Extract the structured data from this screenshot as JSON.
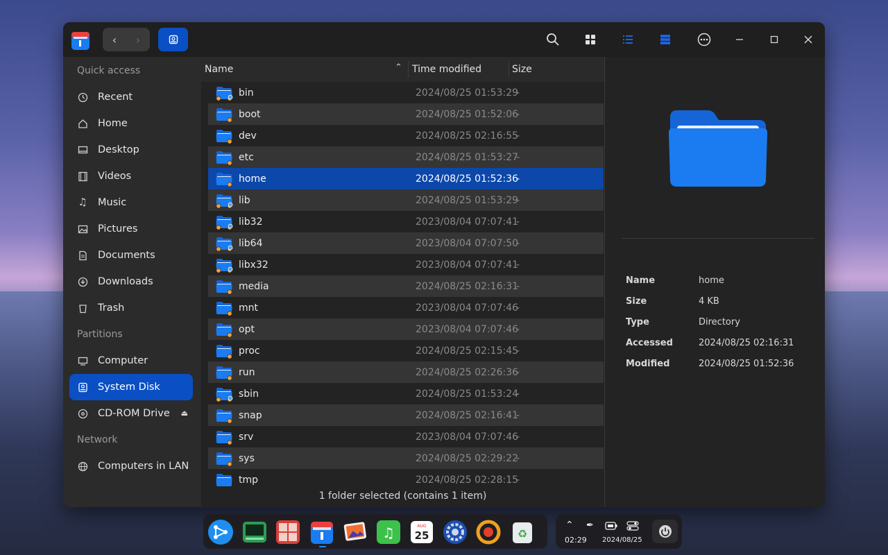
{
  "sidebar": {
    "quick_access": "Quick access",
    "items_quick": [
      {
        "label": "Recent",
        "icon": "clock-icon"
      },
      {
        "label": "Home",
        "icon": "home-icon"
      },
      {
        "label": "Desktop",
        "icon": "desktop-icon"
      },
      {
        "label": "Videos",
        "icon": "film-icon"
      },
      {
        "label": "Music",
        "icon": "music-icon"
      },
      {
        "label": "Pictures",
        "icon": "image-icon"
      },
      {
        "label": "Documents",
        "icon": "document-icon"
      },
      {
        "label": "Downloads",
        "icon": "download-icon"
      },
      {
        "label": "Trash",
        "icon": "trash-icon"
      }
    ],
    "partitions": "Partitions",
    "items_partitions": [
      {
        "label": "Computer",
        "icon": "computer-icon"
      },
      {
        "label": "System Disk",
        "icon": "disk-icon",
        "selected": true
      },
      {
        "label": "CD-ROM Drive",
        "icon": "cdrom-icon"
      }
    ],
    "network": "Network",
    "items_network": [
      {
        "label": "Computers in LAN",
        "icon": "network-icon"
      }
    ]
  },
  "columns": {
    "name": "Name",
    "time": "Time modified",
    "size": "Size"
  },
  "files": [
    {
      "name": "bin",
      "time": "2024/08/25 01:53:29",
      "size": "-"
    },
    {
      "name": "boot",
      "time": "2024/08/25 01:52:06",
      "size": "-"
    },
    {
      "name": "dev",
      "time": "2024/08/25 02:16:55",
      "size": "-"
    },
    {
      "name": "etc",
      "time": "2024/08/25 01:53:27",
      "size": "-"
    },
    {
      "name": "home",
      "time": "2024/08/25 01:52:36",
      "size": "-",
      "selected": true
    },
    {
      "name": "lib",
      "time": "2024/08/25 01:53:29",
      "size": "-"
    },
    {
      "name": "lib32",
      "time": "2023/08/04 07:07:41",
      "size": "-"
    },
    {
      "name": "lib64",
      "time": "2023/08/04 07:07:50",
      "size": "-"
    },
    {
      "name": "libx32",
      "time": "2023/08/04 07:07:41",
      "size": "-"
    },
    {
      "name": "media",
      "time": "2024/08/25 02:16:31",
      "size": "-"
    },
    {
      "name": "mnt",
      "time": "2023/08/04 07:07:46",
      "size": "-"
    },
    {
      "name": "opt",
      "time": "2023/08/04 07:07:46",
      "size": "-"
    },
    {
      "name": "proc",
      "time": "2024/08/25 02:15:45",
      "size": "-"
    },
    {
      "name": "run",
      "time": "2024/08/25 02:26:36",
      "size": "-"
    },
    {
      "name": "sbin",
      "time": "2024/08/25 01:53:24",
      "size": "-"
    },
    {
      "name": "snap",
      "time": "2024/08/25 02:16:41",
      "size": "-"
    },
    {
      "name": "srv",
      "time": "2023/08/04 07:07:46",
      "size": "-"
    },
    {
      "name": "sys",
      "time": "2024/08/25 02:29:22",
      "size": "-"
    },
    {
      "name": "tmp",
      "time": "2024/08/25 02:28:15",
      "size": "-"
    }
  ],
  "status": "1 folder selected (contains 1 item)",
  "details": {
    "name_label": "Name",
    "name_value": "home",
    "size_label": "Size",
    "size_value": "4 KB",
    "type_label": "Type",
    "type_value": "Directory",
    "accessed_label": "Accessed",
    "accessed_value": "2024/08/25 02:16:31",
    "modified_label": "Modified",
    "modified_value": "2024/08/25 01:52:36"
  },
  "taskbar": {
    "calendar_month": "AUG",
    "calendar_day": "25",
    "time": "02:29",
    "date": "2024/08/25"
  },
  "colors": {
    "accent": "#0b4fc4",
    "selected_row": "#0c47aa",
    "folder_blue": "#1a7cf0"
  }
}
